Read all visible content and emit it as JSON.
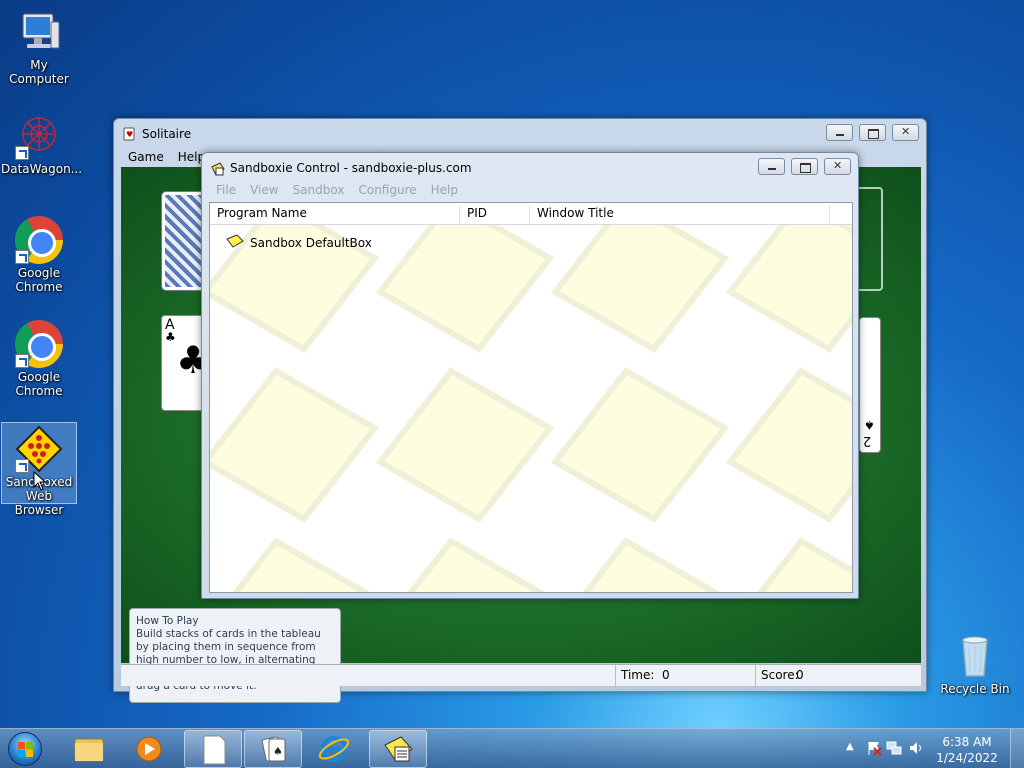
{
  "desktop": {
    "icons": [
      {
        "label": "My Computer"
      },
      {
        "label": "DataWagon..."
      },
      {
        "label": "Google Chrome"
      },
      {
        "label": "Google Chrome"
      },
      {
        "label": "Sandboxed Web Browser"
      },
      {
        "label": "Recycle Bin"
      }
    ]
  },
  "solitaire": {
    "title": "Solitaire",
    "menu": [
      "Game",
      "Help"
    ],
    "how_to_play": {
      "heading": "How To Play",
      "text": "Build stacks of cards in the tableau by placing them in sequence from high number to low, in alternating suit colors red and black. Click and drag a card to move it."
    },
    "cards": {
      "ace_rank": "A",
      "ace_suit": "♣",
      "two_rank": "2",
      "two_suit": "♠"
    },
    "status": {
      "time_label": "Time:",
      "time_value": "0",
      "score_label": "Score:",
      "score_value": "0"
    }
  },
  "sandboxie": {
    "title": "Sandboxie Control - sandboxie-plus.com",
    "menu": [
      "File",
      "View",
      "Sandbox",
      "Configure",
      "Help"
    ],
    "columns": [
      "Program Name",
      "PID",
      "Window Title"
    ],
    "rows": [
      {
        "name": "Sandbox DefaultBox"
      }
    ]
  },
  "taskbar": {
    "clock_time": "6:38 AM",
    "clock_date": "1/24/2022"
  }
}
